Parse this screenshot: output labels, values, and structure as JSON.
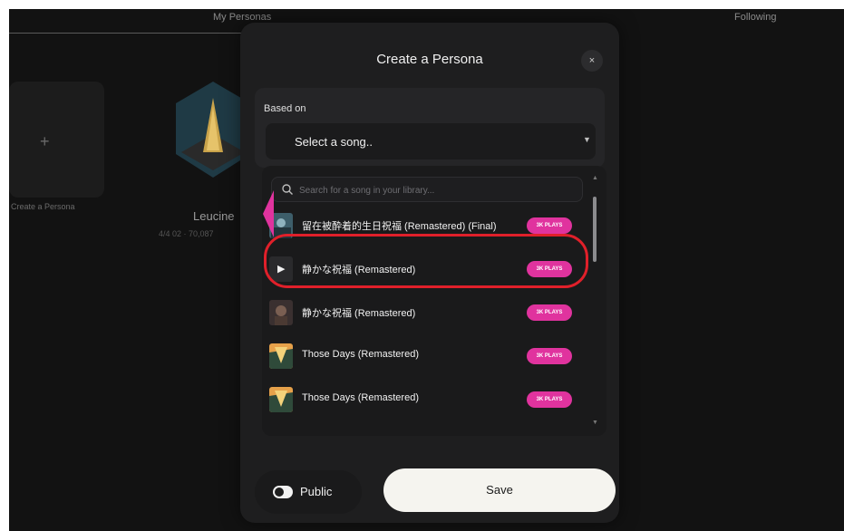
{
  "tabs": {
    "my_personas": "My Personas",
    "following": "Following"
  },
  "background": {
    "create_label": "Create a Persona",
    "persona_name": "Leucine",
    "persona_meta": "4/4 02 · 70,087"
  },
  "modal": {
    "title": "Create a Persona",
    "close_icon": "×",
    "based_on_label": "Based on",
    "select_value": "Select a song..",
    "search_placeholder": "Search for a song in your library...",
    "songs": [
      {
        "title": "留在被酔着的生日祝福 (Remastered) (Final)",
        "badge": "3K PLAYS",
        "thumb": "character-art"
      },
      {
        "title": "静かな祝福 (Remastered)",
        "badge": "3K PLAYS",
        "thumb": "play-icon"
      },
      {
        "title": "静かな祝福 (Remastered)",
        "badge": "3K PLAYS",
        "thumb": "character-art"
      },
      {
        "title": "Those Days (Remastered)",
        "badge": "3K PLAYS",
        "thumb": "sunset-art"
      },
      {
        "title": "Those Days (Remastered)",
        "badge": "3K PLAYS",
        "thumb": "sunset-art"
      }
    ],
    "public_label": "Public",
    "public_enabled": true,
    "save_label": "Save"
  },
  "colors": {
    "accent_badge": "#e0339e",
    "highlight": "#e0202a",
    "background": "#121212",
    "modal": "#1e1e1f"
  }
}
